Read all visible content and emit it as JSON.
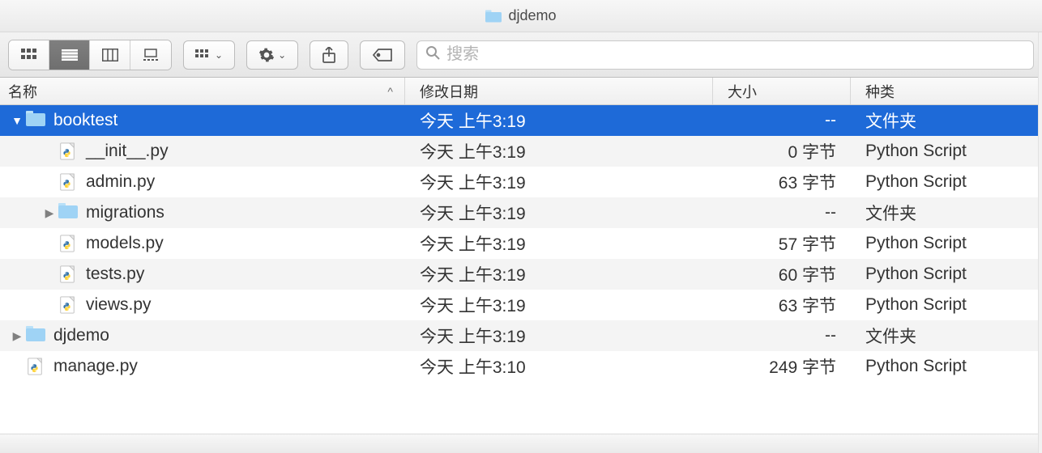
{
  "window": {
    "title": "djdemo"
  },
  "toolbar": {
    "search_placeholder": "搜索"
  },
  "columns": {
    "name": "名称",
    "date": "修改日期",
    "size": "大小",
    "kind": "种类",
    "sort": "^"
  },
  "rows": [
    {
      "indent": 0,
      "disclosure": "down",
      "icon": "folder",
      "name": "booktest",
      "date": "今天 上午3:19",
      "size": "--",
      "kind": "文件夹",
      "selected": true
    },
    {
      "indent": 1,
      "disclosure": "none",
      "icon": "py",
      "name": "__init__.py",
      "date": "今天 上午3:19",
      "size": "0 字节",
      "kind": "Python Script",
      "selected": false
    },
    {
      "indent": 1,
      "disclosure": "none",
      "icon": "py",
      "name": "admin.py",
      "date": "今天 上午3:19",
      "size": "63 字节",
      "kind": "Python Script",
      "selected": false
    },
    {
      "indent": 1,
      "disclosure": "right",
      "icon": "folder",
      "name": "migrations",
      "date": "今天 上午3:19",
      "size": "--",
      "kind": "文件夹",
      "selected": false
    },
    {
      "indent": 1,
      "disclosure": "none",
      "icon": "py",
      "name": "models.py",
      "date": "今天 上午3:19",
      "size": "57 字节",
      "kind": "Python Script",
      "selected": false
    },
    {
      "indent": 1,
      "disclosure": "none",
      "icon": "py",
      "name": "tests.py",
      "date": "今天 上午3:19",
      "size": "60 字节",
      "kind": "Python Script",
      "selected": false
    },
    {
      "indent": 1,
      "disclosure": "none",
      "icon": "py",
      "name": "views.py",
      "date": "今天 上午3:19",
      "size": "63 字节",
      "kind": "Python Script",
      "selected": false
    },
    {
      "indent": 0,
      "disclosure": "right",
      "icon": "folder",
      "name": "djdemo",
      "date": "今天 上午3:19",
      "size": "--",
      "kind": "文件夹",
      "selected": false
    },
    {
      "indent": 0,
      "disclosure": "none",
      "icon": "py",
      "name": "manage.py",
      "date": "今天 上午3:10",
      "size": "249 字节",
      "kind": "Python Script",
      "selected": false
    }
  ]
}
